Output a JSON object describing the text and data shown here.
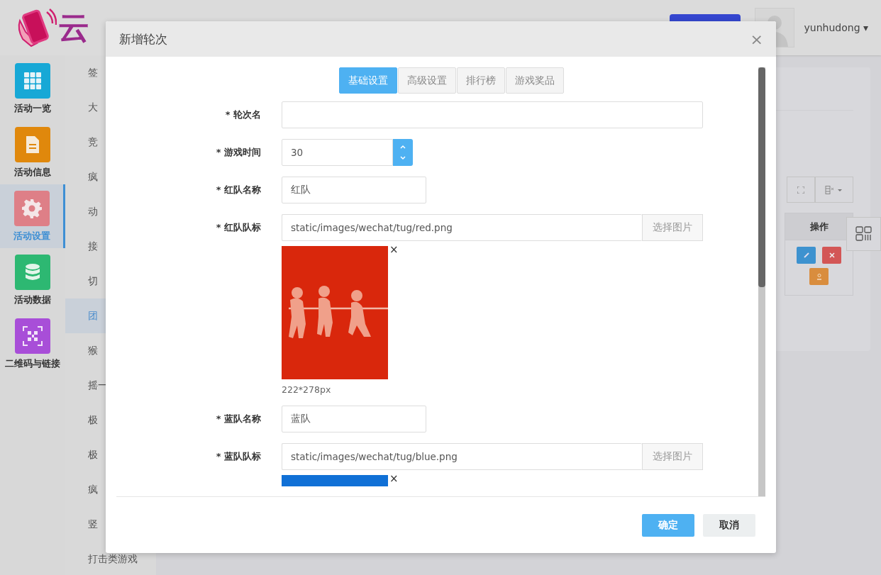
{
  "brand": {
    "name": "云"
  },
  "user": {
    "name": "yunhudong",
    "caret": "▾"
  },
  "nav": [
    {
      "label": "活动一览",
      "color": "#17a8d6",
      "selected": false
    },
    {
      "label": "活动信息",
      "color": "#e0880c",
      "selected": false
    },
    {
      "label": "活动设置",
      "color": "#de7f87",
      "selected": true
    },
    {
      "label": "活动数据",
      "color": "#2db872",
      "selected": false
    },
    {
      "label": "二维码与链接",
      "color": "#a84ed8",
      "selected": false
    }
  ],
  "submenu": [
    {
      "label": "签",
      "selected": false
    },
    {
      "label": "大",
      "selected": false
    },
    {
      "label": "竞",
      "selected": false
    },
    {
      "label": "疯",
      "selected": false
    },
    {
      "label": "动",
      "selected": false
    },
    {
      "label": "接",
      "selected": false
    },
    {
      "label": "切",
      "selected": false
    },
    {
      "label": "团",
      "selected": true
    },
    {
      "label": "猴",
      "selected": false
    },
    {
      "label": "摇一",
      "selected": false
    },
    {
      "label": "极",
      "selected": false
    },
    {
      "label": "极",
      "selected": false
    },
    {
      "label": "疯",
      "selected": false
    },
    {
      "label": "竖",
      "selected": false
    },
    {
      "label": "打击类游戏",
      "selected": false
    }
  ],
  "table": {
    "columns": [
      "操作"
    ]
  },
  "dialog": {
    "title": "新增轮次",
    "close": "×",
    "tabs": [
      {
        "label": "基础设置",
        "selected": true
      },
      {
        "label": "高级设置",
        "selected": false
      },
      {
        "label": "排行榜",
        "selected": false
      },
      {
        "label": "游戏奖品",
        "selected": false
      }
    ],
    "fields": [
      {
        "kind": "wide-text",
        "label": "* 轮次名"
      },
      {
        "kind": "number",
        "label": "* 游戏时间",
        "value": "30"
      },
      {
        "kind": "short-text",
        "label": "* 红队名称",
        "value": "红队"
      },
      {
        "label": "* 红队队标",
        "value": "static/images/wechat/tug/red.png",
        "button": "选择图片",
        "remove": "×",
        "preview": {
          "color": "#d9270c",
          "size_note": "222*278px",
          "cut": false
        }
      },
      {
        "kind": "short-text",
        "label": "* 蓝队名称",
        "value": "蓝队"
      },
      {
        "label": "* 蓝队队标",
        "value": "static/images/wechat/tug/blue.png",
        "button": "选择图片",
        "remove": "×",
        "preview": {
          "color": "#1070d6",
          "cut": true
        }
      }
    ],
    "buttons": [
      {
        "label": "确定",
        "kind": "primary"
      },
      {
        "label": "取消",
        "kind": "default"
      }
    ]
  }
}
